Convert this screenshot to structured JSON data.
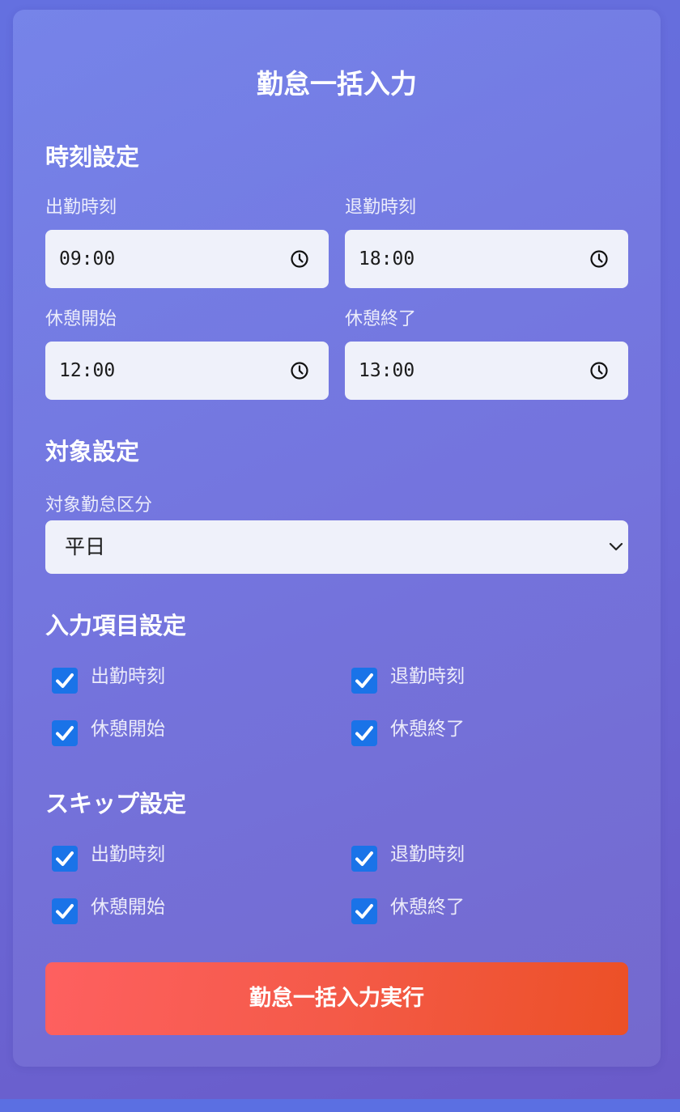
{
  "title": "勤怠一括入力",
  "time_settings": {
    "heading": "時刻設定",
    "fields": [
      {
        "label": "出勤時刻",
        "value": "09:00"
      },
      {
        "label": "退勤時刻",
        "value": "18:00"
      },
      {
        "label": "休憩開始",
        "value": "12:00"
      },
      {
        "label": "休憩終了",
        "value": "13:00"
      }
    ]
  },
  "target_settings": {
    "heading": "対象設定",
    "select_label": "対象勤怠区分",
    "select_value": "平日"
  },
  "input_items": {
    "heading": "入力項目設定",
    "items": [
      {
        "label": "出勤時刻",
        "checked": true
      },
      {
        "label": "退勤時刻",
        "checked": true
      },
      {
        "label": "休憩開始",
        "checked": true
      },
      {
        "label": "休憩終了",
        "checked": true
      }
    ]
  },
  "skip_settings": {
    "heading": "スキップ設定",
    "items": [
      {
        "label": "出勤時刻",
        "checked": true
      },
      {
        "label": "退勤時刻",
        "checked": true
      },
      {
        "label": "休憩開始",
        "checked": true
      },
      {
        "label": "休憩終了",
        "checked": true
      }
    ]
  },
  "submit_label": "勤怠一括入力実行",
  "colors": {
    "checkbox_accent": "#1a73e8",
    "submit_gradient_start": "#fe6060",
    "submit_gradient_end": "#ec5026"
  },
  "icons": {
    "time_input": "clock-icon",
    "select": "chevron-down-icon",
    "checkbox": "checkmark-icon"
  }
}
